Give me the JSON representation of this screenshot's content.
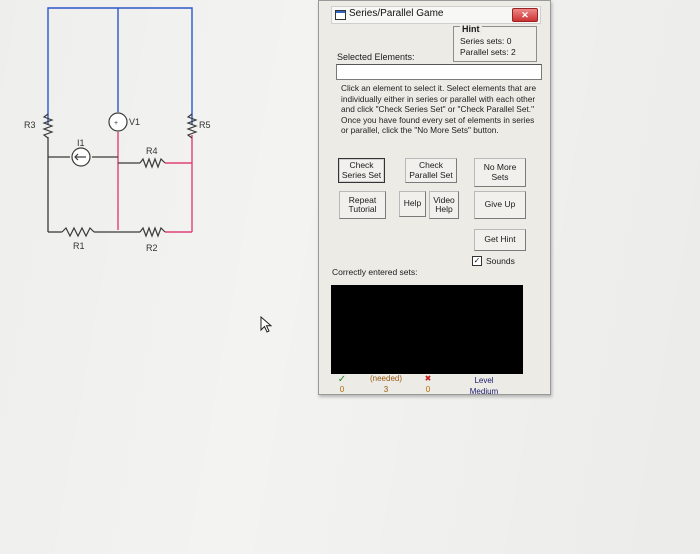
{
  "circuit": {
    "labels": {
      "r3": "R3",
      "v1": "V1",
      "r5": "R5",
      "i1": "I1",
      "r4": "R4",
      "r1": "R1",
      "r2": "R2"
    }
  },
  "dialog": {
    "title": "Series/Parallel Game",
    "close_label": "✕",
    "hint": {
      "title": "Hint",
      "series_sets": "Series sets: 0",
      "parallel_sets": "Parallel sets: 2"
    },
    "selected_label": "Selected Elements:",
    "selected_value": "",
    "instructions": "Click an element to select it. Select elements that are individually either in series or parallel with each other and click \"Check Series Set\" or \"Check Parallel Set.\" Once you have found every set of elements in series or parallel, click the \"No More Sets\" button.",
    "buttons": {
      "check_series": "Check Series Set",
      "check_parallel": "Check Parallel Set",
      "no_more_sets": "No More Sets",
      "repeat_tutorial": "Repeat Tutorial",
      "help": "Help",
      "video_help": "Video Help",
      "give_up": "Give Up",
      "get_hint": "Get Hint"
    },
    "sounds_label": "Sounds",
    "sounds_checked": true,
    "correct_label": "Correctly entered sets:",
    "stats": {
      "correct_icon": "✓",
      "correct_count": "0",
      "needed_label": "(needed)",
      "needed_count": "3",
      "wrong_icon": "✖",
      "wrong_count": "0",
      "level_label": "Level",
      "level_value": "Medium"
    }
  },
  "colors": {
    "wire_blue": "#2d55c9",
    "wire_red": "#e0407a",
    "wire_black": "#3a3a3a",
    "screen_bg": "#f3f3f1",
    "dialog_bg": "#ecebe6"
  },
  "icons": [
    "window-icon",
    "close-icon",
    "checkmark-icon",
    "cross-icon",
    "checkbox-checked-icon",
    "mouse-cursor-icon"
  ]
}
